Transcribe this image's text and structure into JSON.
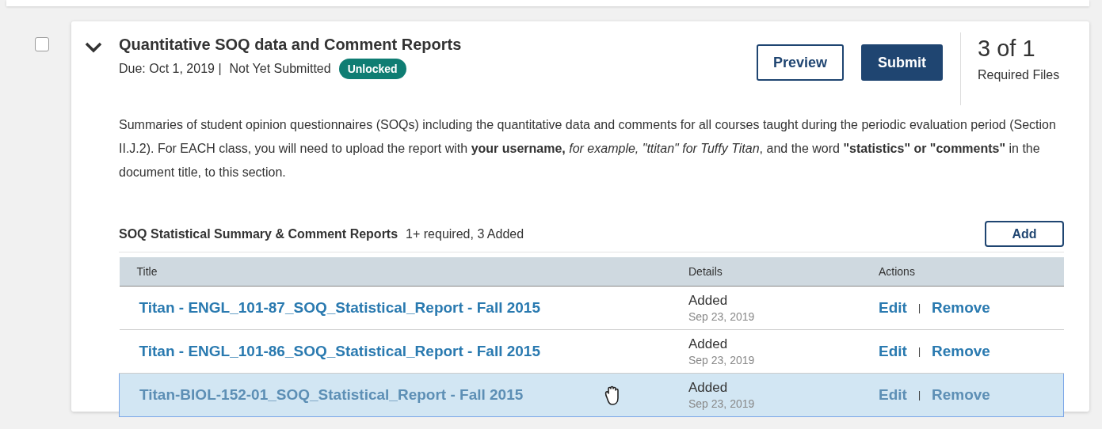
{
  "item": {
    "checked": false,
    "expanded": true,
    "title": "Quantitative SOQ data and Comment Reports",
    "due": "Due: Oct 1, 2019 |",
    "status": "Not Yet Submitted",
    "badge": "Unlocked",
    "buttons": [
      {
        "label": "Preview",
        "kind": "outline"
      },
      {
        "label": "Submit",
        "kind": "primary"
      }
    ],
    "count": "3 of 1",
    "count_label": "Required Files",
    "description": "Summaries of student opinion questionnaires (SOQs) including the quantitative data and comments for all courses taught during the periodic evaluation period (Section II.J.2). For EACH class, you will need to upload the report with **your username,** *for example, \"ttitan\" for Tuffy Titan*, and the word **\"statistics\" or \"comments\"** in the document title, to this section.",
    "section": {
      "title": "SOQ Statistical Summary & Comment Reports",
      "info": "1+ required, 3 Added",
      "add": "Add"
    },
    "table": {
      "columns": [
        "Title",
        "Details",
        "Actions"
      ],
      "rows": [
        {
          "title": "Titan - ENGL_101-87_SOQ_Statistical_Report - Fall 2015",
          "status": "Added",
          "date": "Sep 23, 2019",
          "edit": "Edit",
          "separator": "|",
          "remove": "Remove",
          "selected": false
        },
        {
          "title": "Titan - ENGL_101-86_SOQ_Statistical_Report - Fall 2015",
          "status": "Added",
          "date": "Sep 23, 2019",
          "edit": "Edit",
          "separator": "|",
          "remove": "Remove",
          "selected": false
        },
        {
          "title": "Titan-BIOL-152-01_SOQ_Statistical_Report - Fall 2015",
          "status": "Added",
          "date": "Sep 23, 2019",
          "edit": "Edit",
          "separator": "|",
          "remove": "Remove",
          "selected": true
        }
      ]
    }
  }
}
